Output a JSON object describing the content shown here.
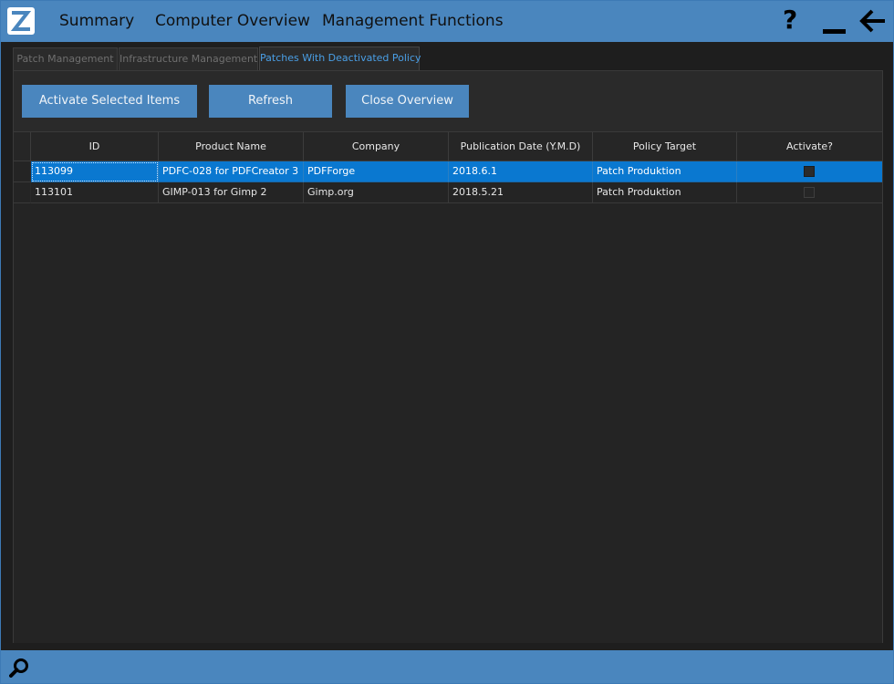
{
  "nav": {
    "items": [
      "Summary",
      "Computer Overview",
      "Management Functions"
    ],
    "icons": {
      "logo": "app-logo",
      "help": "question-mark-icon",
      "minimize": "minimize-icon",
      "back": "arrow-left-icon"
    },
    "help_glyph": "?"
  },
  "tabs": [
    {
      "label": "Patch Management",
      "active": false
    },
    {
      "label": "Infrastructure Management",
      "active": false
    },
    {
      "label": "Patches With Deactivated Policy",
      "active": true
    }
  ],
  "toolbar": {
    "activate_label": "Activate Selected Items",
    "refresh_label": "Refresh",
    "close_label": "Close Overview"
  },
  "table": {
    "columns": [
      "ID",
      "Product Name",
      "Company",
      "Publication Date (Y.M.D)",
      "Policy Target",
      "Activate?"
    ],
    "rows": [
      {
        "id": "113099",
        "product": "PDFC-028 for PDFCreator 3",
        "company": "PDFForge",
        "date": "2018.6.1",
        "target": "Patch Produktion",
        "activate": false,
        "selected": true
      },
      {
        "id": "113101",
        "product": "GIMP-013 for Gimp 2",
        "company": "Gimp.org",
        "date": "2018.5.21",
        "target": "Patch Produktion",
        "activate": false,
        "selected": false
      }
    ]
  },
  "colors": {
    "accent": "#4a86be",
    "selection": "#0a78d0",
    "active_tab_text": "#4a9fe6",
    "background": "#1e1e1e"
  },
  "footer": {
    "icon": "search-icon"
  }
}
